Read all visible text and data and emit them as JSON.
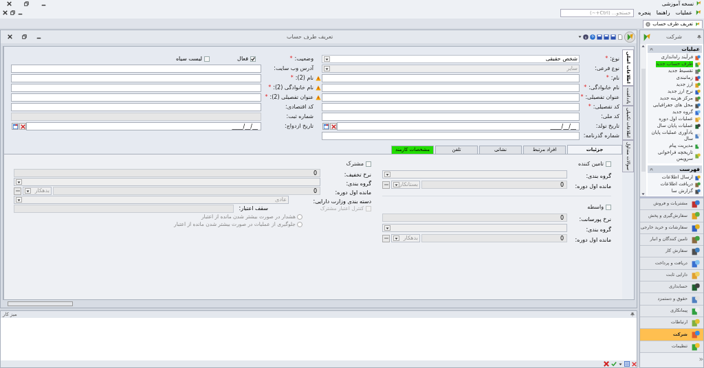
{
  "app": {
    "title": "نسخه آموزشی"
  },
  "menu": [
    {
      "label": "عملیات"
    },
    {
      "label": "راهنما"
    },
    {
      "label": "پنجره"
    }
  ],
  "search": {
    "placeholder": "جستجو... (Ctrl+~)"
  },
  "doc_tabs": [
    {
      "label": "تعریف طرف حساب",
      "selected": true
    }
  ],
  "window": {
    "title": "تعریف طرف حساب"
  },
  "side_tabs": [
    {
      "label": "اطلاعات اصلی",
      "selected": true
    },
    {
      "label": "یادداشت",
      "selected": false
    },
    {
      "label": "اطلاعات تکمیلی",
      "selected": false
    },
    {
      "label": "سوالات متداول",
      "selected": false
    }
  ],
  "form": {
    "right": [
      {
        "kind": "dropdown",
        "label": "نوع:",
        "required_mark": "*",
        "value": "شخص حقیقی",
        "disabled": false
      },
      {
        "kind": "dropdown",
        "label": "نوع فرعی:",
        "value": "سایر",
        "disabled": true
      },
      {
        "kind": "text",
        "label": "نام:",
        "required_mark": "*",
        "warning": true,
        "disabled": false
      },
      {
        "kind": "text",
        "label": "نام خانوادگی:",
        "required_mark": "*",
        "warning": true,
        "disabled": false
      },
      {
        "kind": "text",
        "label": "عنوان تفصیلی:",
        "required_mark": "*",
        "warning": true,
        "disabled": false
      },
      {
        "kind": "text",
        "label": "کد تفصیلی:",
        "required_mark": "*",
        "disabled": false
      },
      {
        "kind": "text",
        "label": "کد ملی:",
        "disabled": false
      },
      {
        "kind": "date",
        "label": "تاریخ تولد:",
        "value": "____/__/__"
      },
      {
        "kind": "text",
        "label": "شماره گذرنامه:",
        "disabled": false
      }
    ],
    "left": [
      {
        "kind": "checks",
        "label": "وضعیت:",
        "required_mark": "*",
        "checks": [
          {
            "label": "فعال",
            "checked": true
          },
          {
            "label": "لیست سیاه",
            "checked": false
          }
        ]
      },
      {
        "kind": "text",
        "label": "آدرس وب سایت:",
        "disabled": false
      },
      {
        "kind": "text",
        "label": "نام (2):",
        "required_mark": "*",
        "disabled": false
      },
      {
        "kind": "text",
        "label": "نام خانوادگی (2):",
        "required_mark": "*",
        "disabled": false
      },
      {
        "kind": "text",
        "label": "عنوان تفصیلی (2):",
        "required_mark": "*",
        "disabled": false
      },
      {
        "kind": "text",
        "label": "کد اقتصادی:",
        "disabled": false
      },
      {
        "kind": "text",
        "label": "شماره ثبت:",
        "disabled": true
      },
      {
        "kind": "date",
        "label": "تاریخ ازدواج:",
        "value": "____/__/__"
      }
    ]
  },
  "tabs": [
    {
      "label": "جزئیات",
      "selected": true,
      "highlighted": false
    },
    {
      "label": "افراد مرتبط",
      "selected": false,
      "highlighted": false
    },
    {
      "label": "نشانی",
      "selected": false,
      "highlighted": false
    },
    {
      "label": "تلفن",
      "selected": false,
      "highlighted": false
    },
    {
      "label": "مشخصات کارمند",
      "selected": false,
      "highlighted": true
    }
  ],
  "details": {
    "right_groups": [
      [
        {
          "kind": "check",
          "label": "تامین کننده",
          "checked": false,
          "disabled": false
        },
        {
          "kind": "dropdown",
          "label": "گروه بندی:",
          "disabled": true
        },
        {
          "kind": "balance",
          "label": "مانده اول دوره:",
          "value": "0",
          "side": "بستانکار"
        }
      ],
      [
        {
          "kind": "check",
          "label": "واسطه",
          "checked": false,
          "disabled": false
        },
        {
          "kind": "text",
          "label": "نرخ پورسانت:",
          "value": "0",
          "disabled": true
        },
        {
          "kind": "dropdown",
          "label": "گروه بندی:",
          "disabled": true
        },
        {
          "kind": "balance",
          "label": "مانده اول دوره:",
          "value": "0",
          "side": "بدهکار"
        }
      ]
    ],
    "left": [
      {
        "kind": "check",
        "label": "مشترک",
        "checked": false,
        "disabled": false
      },
      {
        "kind": "text",
        "label": "نرخ تخفیف:",
        "value": "0",
        "disabled": true
      },
      {
        "kind": "dropdown",
        "label": "گروه بندی:",
        "disabled": true
      },
      {
        "kind": "balance",
        "label": "مانده اول دوره:",
        "value": "0",
        "side": "بدهکار"
      },
      {
        "kind": "dropdown",
        "label": "دسته بندی وزارت دارایی:",
        "value": "عادی",
        "disabled": true
      },
      {
        "kind": "credit",
        "check": {
          "label": "کنترل اعتبار مشترک",
          "checked": false,
          "disabled": true
        },
        "label": "سقف اعتبار:",
        "disabled": true
      },
      {
        "kind": "radio",
        "label": "هشدار در صورت بیشتر شدن مانده از اعتبار",
        "selected": false
      },
      {
        "kind": "radio",
        "label": "جلوگیری از عملیات در صورت بیشتر شدن مانده از اعتبار",
        "selected": false
      }
    ]
  },
  "sidebar": {
    "title": "شرکت",
    "sections": [
      {
        "title": "عملیات",
        "items": [
          {
            "label": "فرآیند راه‌اندازی",
            "highlighted": false
          },
          {
            "label": "طرف حساب جدید",
            "highlighted": true
          },
          {
            "label": "تقسیط جدید",
            "highlighted": false
          },
          {
            "label": "زمانبندی",
            "highlighted": false
          },
          {
            "label": "ارز جدید",
            "highlighted": false
          },
          {
            "label": "نرخ ارز جدید",
            "highlighted": false
          },
          {
            "label": "مرکز هزینه جدید",
            "highlighted": false
          },
          {
            "label": "محل های جغرافیایی",
            "highlighted": false
          },
          {
            "label": "گروه جدید",
            "highlighted": false
          },
          {
            "label": "عملیات اول دوره",
            "highlighted": false
          },
          {
            "label": "عملیات پایان سال",
            "highlighted": false
          },
          {
            "label": "یادآوری عملیات پایان سال",
            "highlighted": false
          },
          {
            "label": "مدیریت پیام",
            "highlighted": false
          },
          {
            "label": "تاریخچه فراخوانی سرویس",
            "highlighted": false
          }
        ]
      },
      {
        "title": "فهرست",
        "items": [
          {
            "label": "ارسال اطلاعات",
            "highlighted": false
          },
          {
            "label": "دریافت اطلاعات",
            "highlighted": false
          },
          {
            "label": "گزارش سا",
            "highlighted": false
          }
        ]
      }
    ],
    "modules": [
      {
        "label": "مشتریات و فروش",
        "selected": false
      },
      {
        "label": "سفارش‌گیری و پخش",
        "selected": false
      },
      {
        "label": "سفارشات و خرید خارجی",
        "selected": false
      },
      {
        "label": "تامین کنندگان و انبار",
        "selected": false
      },
      {
        "label": "سفارش کار",
        "selected": false
      },
      {
        "label": "دریافت و پرداخت",
        "selected": false
      },
      {
        "label": "دارایی ثابت",
        "selected": false
      },
      {
        "label": "حسابداری",
        "selected": false
      },
      {
        "label": "حقوق و دستمزد",
        "selected": false
      },
      {
        "label": "پیمانکاری",
        "selected": false
      },
      {
        "label": "ارتباطات",
        "selected": false
      },
      {
        "label": "شرکت",
        "selected": true
      },
      {
        "label": "تنظیمات",
        "selected": false
      }
    ]
  },
  "bottom_panel": {
    "title": "میز کار"
  }
}
